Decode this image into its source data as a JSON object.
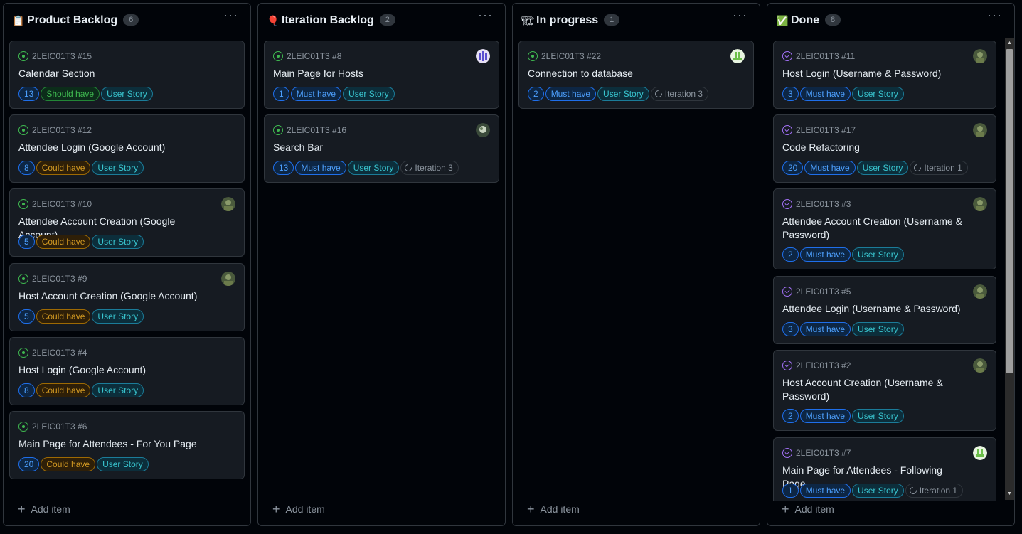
{
  "add_item_label": "Add item",
  "columns": [
    {
      "title": "Product Backlog",
      "count": "6",
      "emoji": "📋",
      "cards": [
        {
          "ref": "2LEIC01T3 #15",
          "title": "Calendar Section",
          "points": "13",
          "priority": "Should have",
          "type": "User Story"
        },
        {
          "ref": "2LEIC01T3 #12",
          "title": "Attendee Login (Google Account)",
          "points": "8",
          "priority": "Could have",
          "type": "User Story"
        },
        {
          "ref": "2LEIC01T3 #10",
          "title": "Attendee Account Creation (Google Account)",
          "points": "5",
          "priority": "Could have",
          "type": "User Story"
        },
        {
          "ref": "2LEIC01T3 #9",
          "title": "Host Account Creation (Google Account)",
          "points": "5",
          "priority": "Could have",
          "type": "User Story"
        },
        {
          "ref": "2LEIC01T3 #4",
          "title": "Host Login (Google Account)",
          "points": "8",
          "priority": "Could have",
          "type": "User Story"
        },
        {
          "ref": "2LEIC01T3 #6",
          "title": "Main Page for Attendees - For You Page",
          "points": "20",
          "priority": "Could have",
          "type": "User Story"
        }
      ]
    },
    {
      "title": "Iteration Backlog",
      "count": "2",
      "emoji": "🎈",
      "cards": [
        {
          "ref": "2LEIC01T3 #8",
          "title": "Main Page for Hosts",
          "points": "1",
          "priority": "Must have",
          "type": "User Story"
        },
        {
          "ref": "2LEIC01T3 #16",
          "title": "Search Bar",
          "points": "13",
          "priority": "Must have",
          "type": "User Story",
          "iteration": "Iteration 3"
        }
      ]
    },
    {
      "title": "In progress",
      "count": "1",
      "emoji": "🏗",
      "cards": [
        {
          "ref": "2LEIC01T3 #22",
          "title": "Connection to database",
          "points": "2",
          "priority": "Must have",
          "type": "User Story",
          "iteration": "Iteration 3"
        }
      ]
    },
    {
      "title": "Done",
      "count": "8",
      "emoji": "✅",
      "cards": [
        {
          "ref": "2LEIC01T3 #11",
          "title": "Host Login (Username & Password)",
          "points": "3",
          "priority": "Must have",
          "type": "User Story"
        },
        {
          "ref": "2LEIC01T3 #17",
          "title": "Code Refactoring",
          "points": "20",
          "priority": "Must have",
          "type": "User Story",
          "iteration": "Iteration 1"
        },
        {
          "ref": "2LEIC01T3 #3",
          "title": "Attendee Account Creation (Username & Password)",
          "points": "2",
          "priority": "Must have",
          "type": "User Story"
        },
        {
          "ref": "2LEIC01T3 #5",
          "title": "Attendee Login (Username & Password)",
          "points": "3",
          "priority": "Must have",
          "type": "User Story"
        },
        {
          "ref": "2LEIC01T3 #2",
          "title": "Host Account Creation (Username & Password)",
          "points": "2",
          "priority": "Must have",
          "type": "User Story"
        },
        {
          "ref": "2LEIC01T3 #7",
          "title": "Main Page for Attendees - Following Page",
          "points": "1",
          "priority": "Must have",
          "type": "User Story",
          "iteration": "Iteration 1"
        }
      ]
    }
  ],
  "colors": {
    "open_issue": "#3fb950",
    "closed_issue": "#a371f7",
    "must_have": "#4d9ffc",
    "should_have": "#3fb950",
    "could_have": "#d29922",
    "user_story": "#39c5cf"
  }
}
